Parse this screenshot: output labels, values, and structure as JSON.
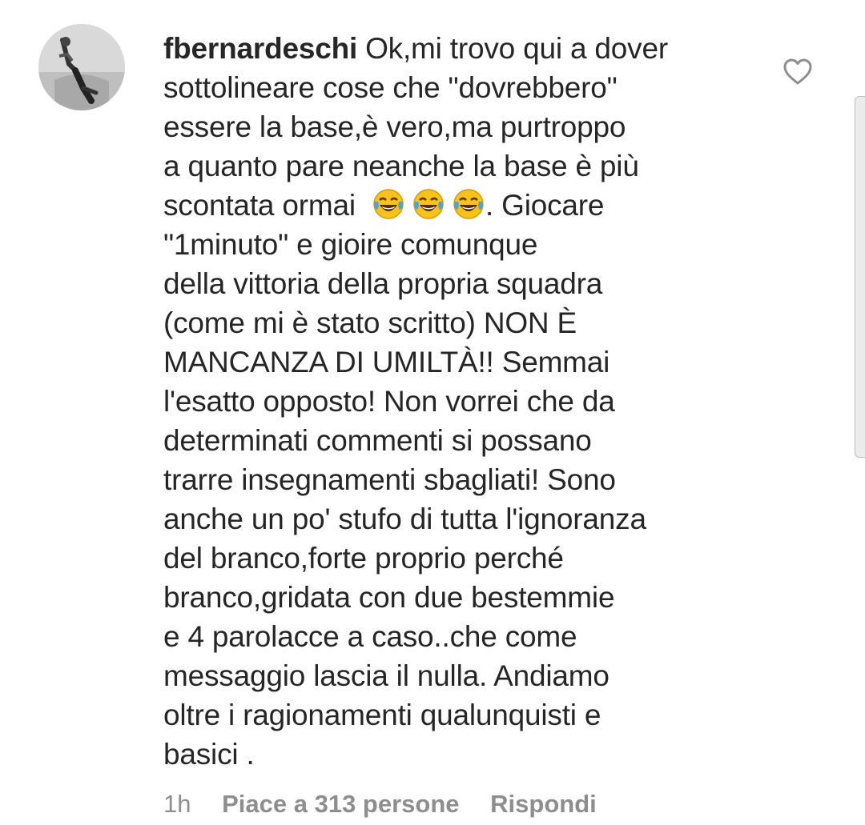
{
  "comment": {
    "username": "fbernardeschi",
    "lines": [
      "Ok,mi trovo qui a dover",
      "sottolineare cose che \"dovrebbero\"",
      "essere la base,è vero,ma purtroppo",
      "a quanto pare neanche la base è più",
      "scontata ormai",
      "\"1minuto\" e gioire comunque",
      "della vittoria della propria squadra",
      "(come mi è stato scritto) NON È",
      "MANCANZA DI UMILTÀ!! Semmai",
      "l'esatto opposto! Non vorrei che da",
      "determinati commenti si possano",
      "trarre insegnamenti sbagliati! Sono",
      "anche un po' stufo di tutta l'ignoranza",
      "del branco,forte proprio perché",
      "branco,gridata con due bestemmie",
      "e 4 parolacce a caso..che come",
      "messaggio lascia il nulla. Andiamo",
      "oltre i ragionamenti qualunquisti e",
      "basici ."
    ],
    "after_emoji": ". Giocare",
    "emojis": [
      "face-with-tears-of-joy",
      "face-with-tears-of-joy",
      "face-with-tears-of-joy"
    ],
    "time": "1h",
    "likes": "Piace a 313 persone",
    "reply": "Rispondi",
    "like_icon": "heart-outline-icon"
  },
  "colors": {
    "text": "#262626",
    "meta": "#8e8e8e",
    "emoji_face": "#f7c21c",
    "emoji_tears": "#4aa3df"
  }
}
